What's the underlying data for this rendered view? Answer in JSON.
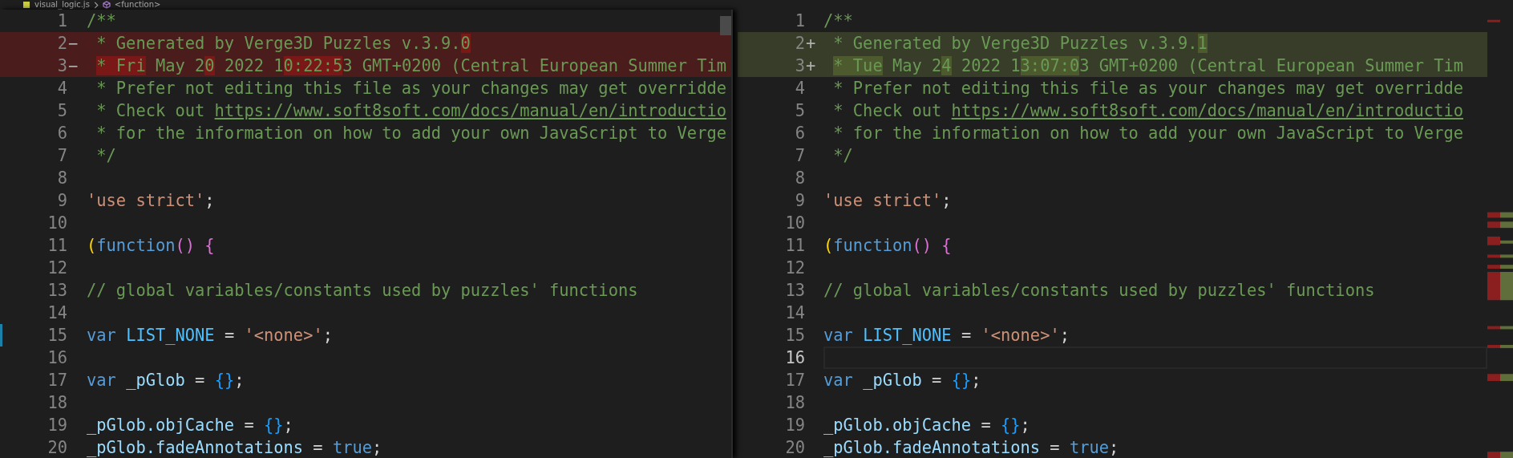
{
  "breadcrumb": [
    {
      "label": "visual_logic.js",
      "kind": "file"
    },
    {
      "label": "<function>",
      "kind": "symbol"
    }
  ],
  "panes": [
    {
      "lines": [
        {
          "number": "1",
          "kind": "context",
          "current": false,
          "marked": false,
          "tokens": [
            {
              "text": "/**",
              "kind": "comment",
              "changed": false
            }
          ]
        },
        {
          "number": "2",
          "marker": "−",
          "kind": "removed",
          "current": false,
          "marked": false,
          "tokens": [
            {
              "text": " * Generated by Verge3D Puzzles v.3.9.",
              "kind": "comment",
              "changed": false
            },
            {
              "text": "0",
              "kind": "comment",
              "changed": true
            }
          ]
        },
        {
          "number": "3",
          "marker": "−",
          "kind": "removed",
          "current": false,
          "marked": false,
          "tokens": [
            {
              "text": " * Fri",
              "kind": "comment",
              "changed": true
            },
            {
              "text": " May 2",
              "kind": "comment",
              "changed": false
            },
            {
              "text": "0",
              "kind": "comment",
              "changed": true
            },
            {
              "text": " 2022 1",
              "kind": "comment",
              "changed": false
            },
            {
              "text": "0:22:5",
              "kind": "comment",
              "changed": true
            },
            {
              "text": "3 GMT+0200 (Central European Summer Tim",
              "kind": "comment",
              "changed": false
            }
          ]
        },
        {
          "number": "4",
          "kind": "context",
          "current": false,
          "marked": false,
          "tokens": [
            {
              "text": " * Prefer not editing this file as your changes may get overridde",
              "kind": "comment",
              "changed": false
            }
          ]
        },
        {
          "number": "5",
          "kind": "context",
          "current": false,
          "marked": false,
          "tokens": [
            {
              "text": " * Check out ",
              "kind": "comment",
              "changed": false
            },
            {
              "text": "https://www.soft8soft.com/docs/manual/en/introductio",
              "kind": "link",
              "changed": false
            }
          ]
        },
        {
          "number": "6",
          "kind": "context",
          "current": false,
          "marked": false,
          "tokens": [
            {
              "text": " * for the information on how to add your own JavaScript to Verge",
              "kind": "comment",
              "changed": false
            }
          ]
        },
        {
          "number": "7",
          "kind": "context",
          "current": false,
          "marked": false,
          "tokens": [
            {
              "text": " */",
              "kind": "comment",
              "changed": false
            }
          ]
        },
        {
          "number": "8",
          "kind": "context",
          "current": false,
          "marked": false
        },
        {
          "number": "9",
          "kind": "context",
          "current": false,
          "marked": false,
          "tokens": [
            {
              "text": "'use strict'",
              "kind": "string",
              "changed": false
            },
            {
              "text": ";",
              "kind": "plain",
              "changed": false
            }
          ]
        },
        {
          "number": "10",
          "kind": "context",
          "current": false,
          "marked": false
        },
        {
          "number": "11",
          "kind": "context",
          "current": false,
          "marked": false,
          "tokens": [
            {
              "text": "(",
              "kind": "bracket1",
              "changed": false
            },
            {
              "text": "function",
              "kind": "keyword",
              "changed": false
            },
            {
              "text": "()",
              "kind": "bracket2",
              "changed": false
            },
            {
              "text": " {",
              "kind": "bracket2",
              "changed": false
            }
          ]
        },
        {
          "number": "12",
          "kind": "context",
          "current": false,
          "marked": false
        },
        {
          "number": "13",
          "kind": "context",
          "current": false,
          "marked": false,
          "tokens": [
            {
              "text": "// global variables/constants used by puzzles' functions",
              "kind": "comment",
              "changed": false
            }
          ]
        },
        {
          "number": "14",
          "kind": "context",
          "current": false,
          "marked": false
        },
        {
          "number": "15",
          "kind": "context",
          "current": false,
          "marked": true,
          "tokens": [
            {
              "text": "var",
              "kind": "keyword",
              "changed": false
            },
            {
              "text": " LIST_NONE",
              "kind": "constant",
              "changed": false
            },
            {
              "text": " = ",
              "kind": "plain",
              "changed": false
            },
            {
              "text": "'<none>'",
              "kind": "string",
              "changed": false
            },
            {
              "text": ";",
              "kind": "plain",
              "changed": false
            }
          ]
        },
        {
          "number": "16",
          "kind": "context",
          "current": false,
          "marked": false
        },
        {
          "number": "17",
          "kind": "context",
          "current": false,
          "marked": false,
          "tokens": [
            {
              "text": "var",
              "kind": "keyword",
              "changed": false
            },
            {
              "text": " _pGlob",
              "kind": "variable",
              "changed": false
            },
            {
              "text": " = ",
              "kind": "plain",
              "changed": false
            },
            {
              "text": "{}",
              "kind": "bracket3",
              "changed": false
            },
            {
              "text": ";",
              "kind": "plain",
              "changed": false
            }
          ]
        },
        {
          "number": "18",
          "kind": "context",
          "current": false,
          "marked": false
        },
        {
          "number": "19",
          "kind": "context",
          "current": false,
          "marked": false,
          "tokens": [
            {
              "text": "_pGlob.objCache",
              "kind": "variable",
              "changed": false
            },
            {
              "text": " = ",
              "kind": "plain",
              "changed": false
            },
            {
              "text": "{}",
              "kind": "bracket3",
              "changed": false
            },
            {
              "text": ";",
              "kind": "plain",
              "changed": false
            }
          ]
        },
        {
          "number": "20",
          "kind": "context",
          "current": false,
          "marked": false,
          "tokens": [
            {
              "text": "_pGlob.fadeAnnotations",
              "kind": "variable",
              "changed": false
            },
            {
              "text": " = ",
              "kind": "plain",
              "changed": false
            },
            {
              "text": "true",
              "kind": "keyword",
              "changed": false
            },
            {
              "text": ";",
              "kind": "plain",
              "changed": false
            }
          ]
        }
      ]
    },
    {
      "lines": [
        {
          "number": "1",
          "kind": "context",
          "current": false,
          "marked": false,
          "tokens": [
            {
              "text": "/**",
              "kind": "comment",
              "changed": false
            }
          ]
        },
        {
          "number": "2",
          "marker": "+",
          "kind": "added",
          "current": false,
          "marked": false,
          "tokens": [
            {
              "text": " * Generated by Verge3D Puzzles v.3.9.",
              "kind": "comment",
              "changed": false
            },
            {
              "text": "1",
              "kind": "comment",
              "changed": true
            }
          ]
        },
        {
          "number": "3",
          "marker": "+",
          "kind": "added",
          "current": false,
          "marked": false,
          "tokens": [
            {
              "text": " * Tue",
              "kind": "comment",
              "changed": true
            },
            {
              "text": " May 2",
              "kind": "comment",
              "changed": false
            },
            {
              "text": "4",
              "kind": "comment",
              "changed": true
            },
            {
              "text": " 2022 1",
              "kind": "comment",
              "changed": false
            },
            {
              "text": "3:07:0",
              "kind": "comment",
              "changed": true
            },
            {
              "text": "3 GMT+0200 (Central European Summer Tim",
              "kind": "comment",
              "changed": false
            }
          ]
        },
        {
          "number": "4",
          "kind": "context",
          "current": false,
          "marked": false,
          "tokens": [
            {
              "text": " * Prefer not editing this file as your changes may get overridde",
              "kind": "comment",
              "changed": false
            }
          ]
        },
        {
          "number": "5",
          "kind": "context",
          "current": false,
          "marked": false,
          "tokens": [
            {
              "text": " * Check out ",
              "kind": "comment",
              "changed": false
            },
            {
              "text": "https://www.soft8soft.com/docs/manual/en/introductio",
              "kind": "link",
              "changed": false
            }
          ]
        },
        {
          "number": "6",
          "kind": "context",
          "current": false,
          "marked": false,
          "tokens": [
            {
              "text": " * for the information on how to add your own JavaScript to Verge",
              "kind": "comment",
              "changed": false
            }
          ]
        },
        {
          "number": "7",
          "kind": "context",
          "current": false,
          "marked": false,
          "tokens": [
            {
              "text": " */",
              "kind": "comment",
              "changed": false
            }
          ]
        },
        {
          "number": "8",
          "kind": "context",
          "current": false,
          "marked": false
        },
        {
          "number": "9",
          "kind": "context",
          "current": false,
          "marked": false,
          "tokens": [
            {
              "text": "'use strict'",
              "kind": "string",
              "changed": false
            },
            {
              "text": ";",
              "kind": "plain",
              "changed": false
            }
          ]
        },
        {
          "number": "10",
          "kind": "context",
          "current": false,
          "marked": false
        },
        {
          "number": "11",
          "kind": "context",
          "current": false,
          "marked": false,
          "tokens": [
            {
              "text": "(",
              "kind": "bracket1",
              "changed": false
            },
            {
              "text": "function",
              "kind": "keyword",
              "changed": false
            },
            {
              "text": "()",
              "kind": "bracket2",
              "changed": false
            },
            {
              "text": " {",
              "kind": "bracket2",
              "changed": false
            }
          ]
        },
        {
          "number": "12",
          "kind": "context",
          "current": false,
          "marked": false
        },
        {
          "number": "13",
          "kind": "context",
          "current": false,
          "marked": false,
          "tokens": [
            {
              "text": "// global variables/constants used by puzzles' functions",
              "kind": "comment",
              "changed": false
            }
          ]
        },
        {
          "number": "14",
          "kind": "context",
          "current": false,
          "marked": false
        },
        {
          "number": "15",
          "kind": "context",
          "current": false,
          "marked": false,
          "tokens": [
            {
              "text": "var",
              "kind": "keyword",
              "changed": false
            },
            {
              "text": " LIST_NONE",
              "kind": "constant",
              "changed": false
            },
            {
              "text": " = ",
              "kind": "plain",
              "changed": false
            },
            {
              "text": "'<none>'",
              "kind": "string",
              "changed": false
            },
            {
              "text": ";",
              "kind": "plain",
              "changed": false
            }
          ]
        },
        {
          "number": "16",
          "kind": "context",
          "current": true,
          "marked": false
        },
        {
          "number": "17",
          "kind": "context",
          "current": false,
          "marked": false,
          "tokens": [
            {
              "text": "var",
              "kind": "keyword",
              "changed": false
            },
            {
              "text": " _pGlob",
              "kind": "variable",
              "changed": false
            },
            {
              "text": " = ",
              "kind": "plain",
              "changed": false
            },
            {
              "text": "{}",
              "kind": "bracket3",
              "changed": false
            },
            {
              "text": ";",
              "kind": "plain",
              "changed": false
            }
          ]
        },
        {
          "number": "18",
          "kind": "context",
          "current": false,
          "marked": false
        },
        {
          "number": "19",
          "kind": "context",
          "current": false,
          "marked": false,
          "tokens": [
            {
              "text": "_pGlob.objCache",
              "kind": "variable",
              "changed": false
            },
            {
              "text": " = ",
              "kind": "plain",
              "changed": false
            },
            {
              "text": "{}",
              "kind": "bracket3",
              "changed": false
            },
            {
              "text": ";",
              "kind": "plain",
              "changed": false
            }
          ]
        },
        {
          "number": "20",
          "kind": "context",
          "current": false,
          "marked": false,
          "tokens": [
            {
              "text": "_pGlob.fadeAnnotations",
              "kind": "variable",
              "changed": false
            },
            {
              "text": " = ",
              "kind": "plain",
              "changed": false
            },
            {
              "text": "true",
              "kind": "keyword",
              "changed": false
            },
            {
              "text": ";",
              "kind": "plain",
              "changed": false
            }
          ]
        }
      ]
    }
  ]
}
